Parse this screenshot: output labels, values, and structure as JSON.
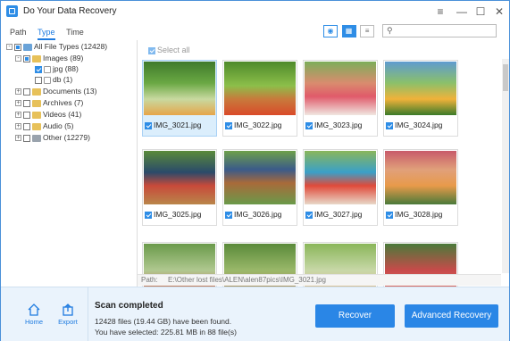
{
  "app": {
    "title": "Do Your Data Recovery"
  },
  "tabs": [
    {
      "label": "Path"
    },
    {
      "label": "Type"
    },
    {
      "label": "Time"
    }
  ],
  "search": {
    "placeholder": ""
  },
  "tree": {
    "root": "All File Types (12428)",
    "images": "Images (89)",
    "jpg": "jpg (88)",
    "db": "db (1)",
    "documents": "Documents (13)",
    "archives": "Archives (7)",
    "videos": "Videos (41)",
    "audio": "Audio (5)",
    "other": "Other (12279)"
  },
  "grid": {
    "select_all": "Select all",
    "items": [
      {
        "name": "IMG_3021.jpg",
        "selected": true
      },
      {
        "name": "IMG_3022.jpg",
        "selected": false
      },
      {
        "name": "IMG_3023.jpg",
        "selected": false
      },
      {
        "name": "IMG_3024.jpg",
        "selected": false
      },
      {
        "name": "IMG_3025.jpg",
        "selected": false
      },
      {
        "name": "IMG_3026.jpg",
        "selected": false
      },
      {
        "name": "IMG_3027.jpg",
        "selected": false
      },
      {
        "name": "IMG_3028.jpg",
        "selected": false
      }
    ]
  },
  "pathbar": {
    "label": "Path:",
    "value": "E:\\Other lost files\\ALEN\\alen87pics\\IMG_3021.jpg"
  },
  "bottom": {
    "home_label": "Home",
    "export_label": "Export",
    "status_title": "Scan completed",
    "found_line": "12428 files (19.44 GB) have been found.",
    "selected_line": "You have selected: 225.81 MB in 88 file(s)",
    "recover_label": "Recover",
    "advanced_label": "Advanced Recovery"
  },
  "colors": {
    "accent": "#2a86e6",
    "bottom_bg": "#eaf3fc"
  }
}
